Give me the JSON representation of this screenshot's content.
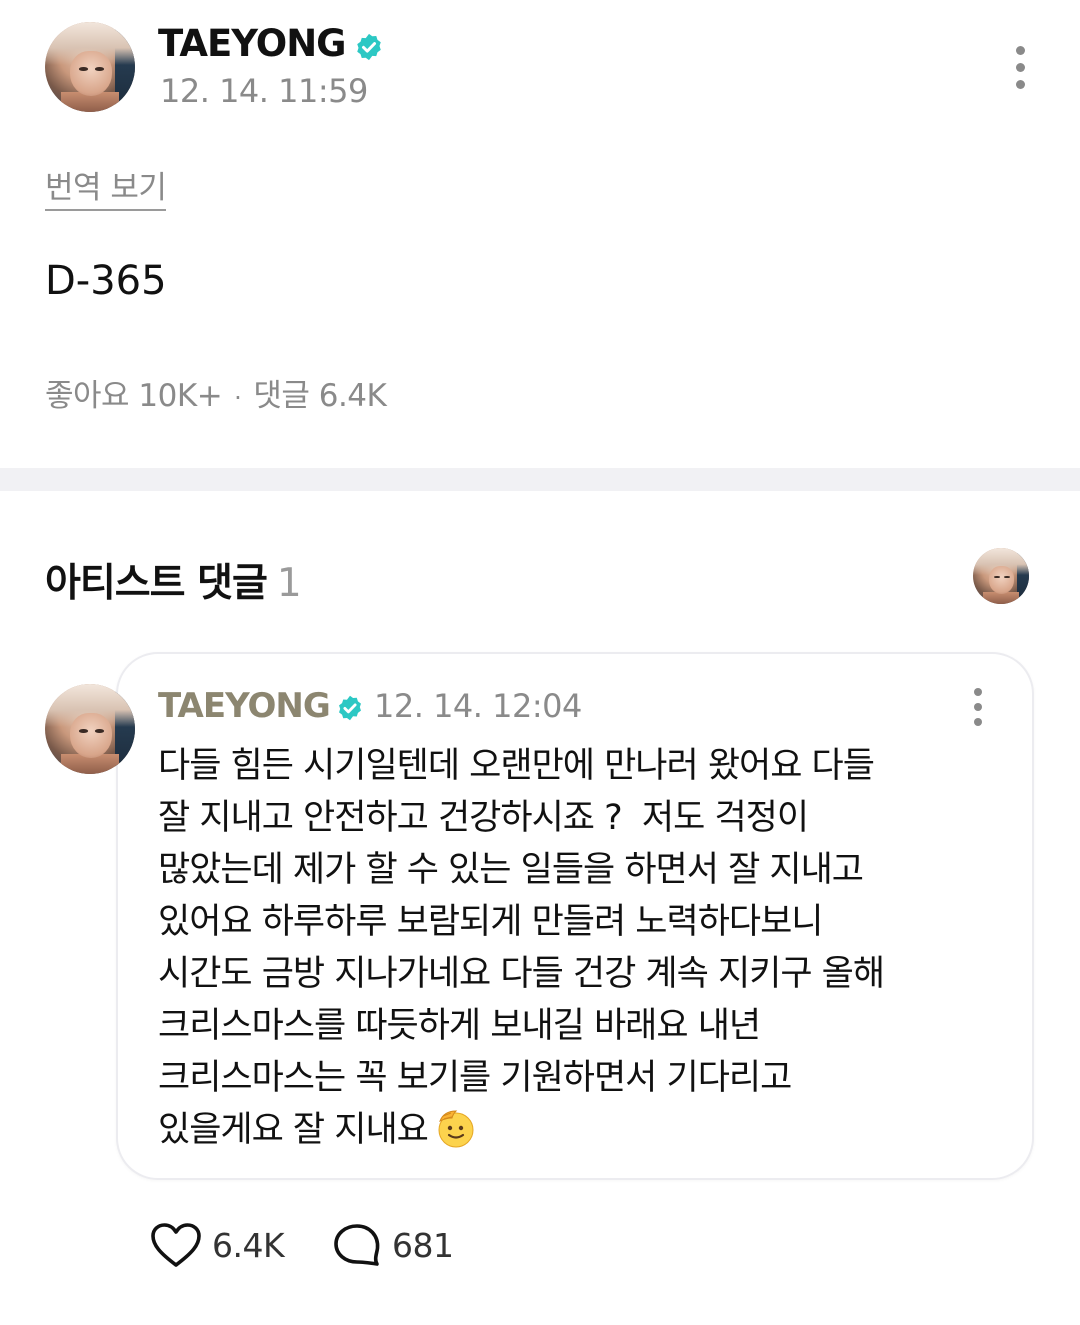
{
  "post": {
    "author": "TAEYONG",
    "time": "12. 14. 11:59",
    "translate_label": "번역 보기",
    "body": "D-365",
    "likes_label": "좋아요",
    "likes_count": "10K+",
    "dot": "·",
    "comments_label": "댓글",
    "comments_count": "6.4K"
  },
  "artist_comments": {
    "title": "아티스트 댓글",
    "count": "1",
    "comment": {
      "author": "TAEYONG",
      "time": "12. 14. 12:04",
      "text": "다들 힘든 시기일텐데 오랜만에 만나러 왔어요 다들\n잘 지내고 안전하고 건강하시죠 ?  저도 걱정이\n많았는데 제가 할 수 있는 일들을 하면서 잘 지내고\n있어요 하루하루 보람되게 만들려 노력하다보니\n시간도 금방 지나가네요 다들 건강 계속 지키구 올해\n크리스마스를 따듯하게 보내길 바래요 내년\n크리스마스는 꼭 보기를 기원하면서 기다리고\n있을게요 잘 지내요",
      "emoji": "saluting-face-icon",
      "likes": "6.4K",
      "replies": "681"
    }
  },
  "colors": {
    "verified": "#2cc8c4",
    "muted": "#8a8a8a",
    "divider": "#f1f1f4"
  },
  "icons": [
    "verified-badge-icon",
    "more-vert-icon",
    "heart-icon",
    "comment-bubble-icon",
    "saluting-face-icon"
  ]
}
